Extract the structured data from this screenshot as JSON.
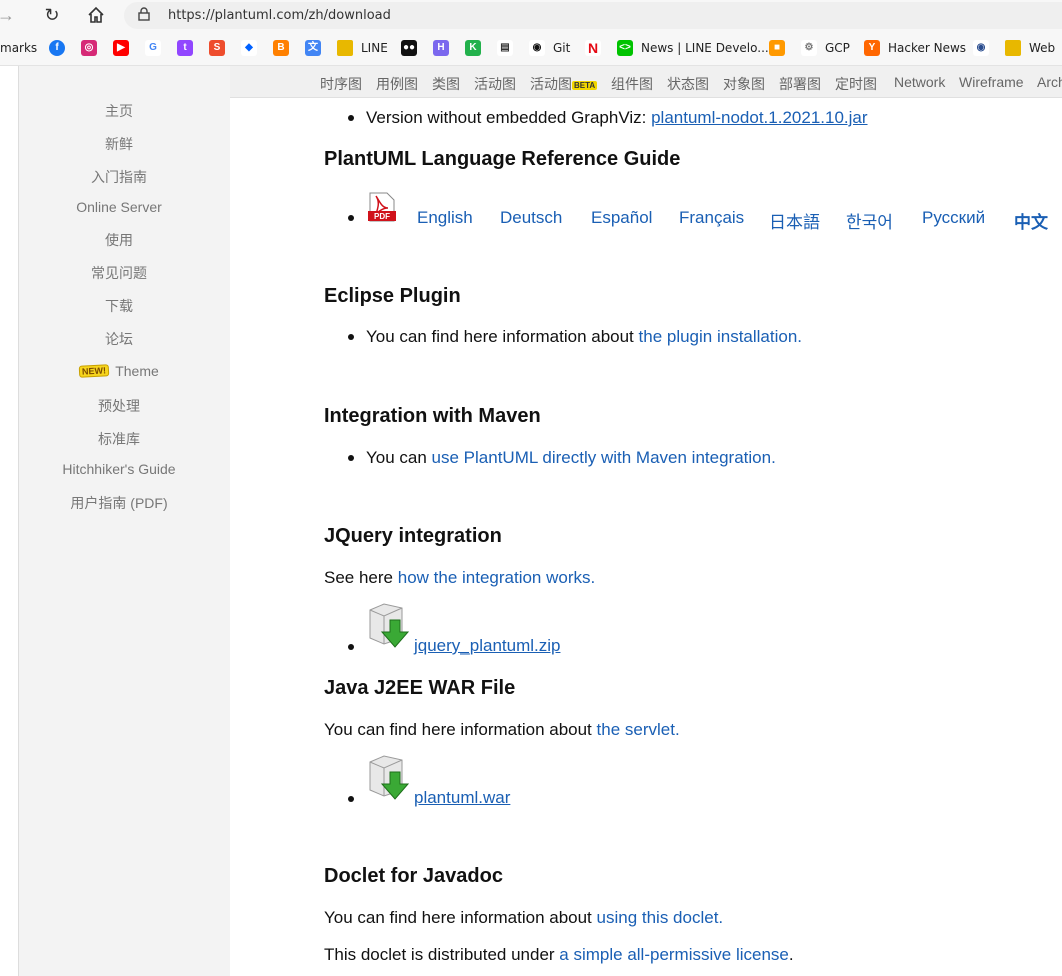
{
  "browser": {
    "url": "https://plantuml.com/zh/download",
    "bookmarks": [
      {
        "label": "marks",
        "icon": "bookmarks-folder-icon"
      },
      {
        "label": "",
        "icon": "facebook-icon"
      },
      {
        "label": "",
        "icon": "instagram-icon"
      },
      {
        "label": "",
        "icon": "youtube-icon"
      },
      {
        "label": "",
        "icon": "google-icon"
      },
      {
        "label": "",
        "icon": "twitch-icon"
      },
      {
        "label": "",
        "icon": "shopee-icon"
      },
      {
        "label": "",
        "icon": "dropbox-icon"
      },
      {
        "label": "",
        "icon": "blogger-icon"
      },
      {
        "label": "",
        "icon": "translate-icon"
      },
      {
        "label": "LINE",
        "icon": "folder-icon"
      },
      {
        "label": "",
        "icon": "medium-icon"
      },
      {
        "label": "",
        "icon": "h-icon"
      },
      {
        "label": "",
        "icon": "k-icon"
      },
      {
        "label": "",
        "icon": "doc-icon"
      },
      {
        "label": "Git",
        "icon": "github-icon"
      },
      {
        "label": "",
        "icon": "netflix-icon"
      },
      {
        "label": "News | LINE Develo...",
        "icon": "line-dev-icon"
      },
      {
        "label": "",
        "icon": "box-icon"
      },
      {
        "label": "GCP",
        "icon": "gcp-icon"
      },
      {
        "label": "Hacker News",
        "icon": "hackernews-icon"
      },
      {
        "label": "",
        "icon": "eye-icon"
      },
      {
        "label": "Web",
        "icon": "folder-icon"
      }
    ]
  },
  "topnav": [
    "时序图",
    "用例图",
    "类图",
    "活动图",
    "活动图",
    "组件图",
    "状态图",
    "对象图",
    "部署图",
    "定时图",
    "Network",
    "Wireframe",
    "Arch"
  ],
  "topnav_beta": "BETA",
  "sidebar": {
    "items": [
      "主页",
      "新鲜",
      "入门指南",
      "Online Server",
      "使用",
      "常见问题",
      "下载",
      "论坛",
      "Theme",
      "预处理",
      "标准库",
      "Hitchhiker's Guide",
      "用户指南 (PDF)"
    ],
    "new_badge": "NEW!"
  },
  "content": {
    "nodot_prefix": "Version without embedded GraphViz: ",
    "nodot_link": "plantuml-nodot.1.2021.10.jar",
    "ref_title": "PlantUML Language Reference Guide",
    "pdf_label": "PDF",
    "languages": [
      "English",
      "Deutsch",
      "Español",
      "Français",
      "日本語",
      "한국어",
      "Русский",
      "中文"
    ],
    "eclipse_title": "Eclipse Plugin",
    "eclipse_prefix": "You can find here information about ",
    "eclipse_link": "the plugin installation.",
    "maven_title": "Integration with Maven",
    "maven_prefix": "You can ",
    "maven_link": "use PlantUML directly with Maven integration.",
    "jquery_title": "JQuery integration",
    "jquery_prefix": "See here ",
    "jquery_link": "how the integration works.",
    "jquery_file": "jquery_plantuml.zip",
    "war_title": "Java J2EE WAR File",
    "war_prefix": "You can find here information about ",
    "war_link": "the servlet.",
    "war_file": "plantuml.war",
    "doclet_title": "Doclet for Javadoc",
    "doclet_prefix": "You can find here information about ",
    "doclet_link": "using this doclet.",
    "license_prefix": "This doclet is distributed under ",
    "license_link": "a simple all-permissive license",
    "license_suffix": "."
  }
}
